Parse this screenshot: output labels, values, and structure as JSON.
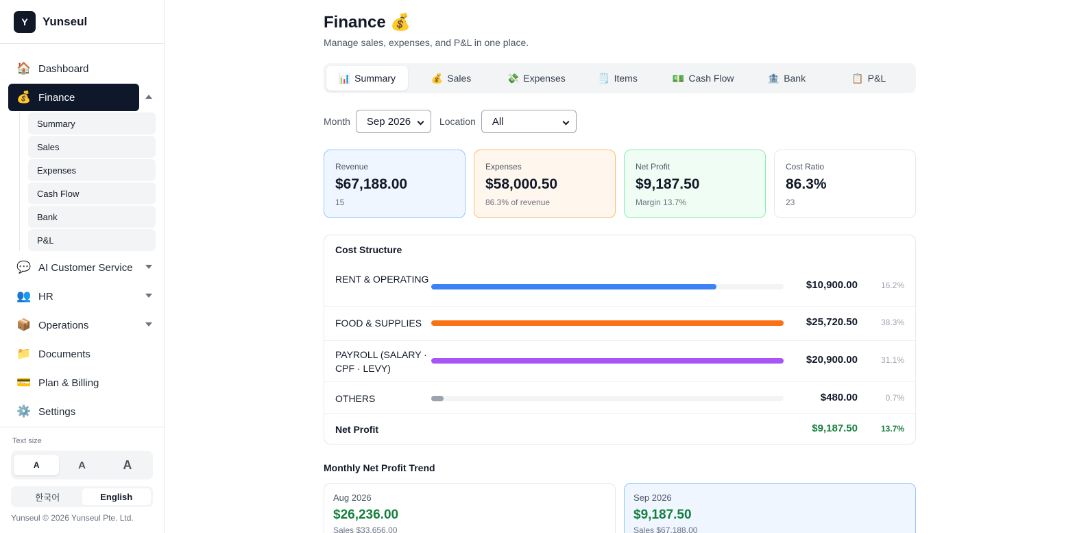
{
  "brand": {
    "logo_letter": "Y",
    "name": "Yunseul"
  },
  "sidebar": {
    "items": [
      {
        "icon": "🏠",
        "label": "Dashboard"
      },
      {
        "icon": "💰",
        "label": "Finance"
      },
      {
        "icon": "💬",
        "label": "AI Customer Service"
      },
      {
        "icon": "👥",
        "label": "HR"
      },
      {
        "icon": "📦",
        "label": "Operations"
      },
      {
        "icon": "📁",
        "label": "Documents"
      },
      {
        "icon": "💳",
        "label": "Plan & Billing"
      },
      {
        "icon": "⚙️",
        "label": "Settings"
      }
    ],
    "finance_sub": [
      "Summary",
      "Sales",
      "Expenses",
      "Cash Flow",
      "Bank",
      "P&L"
    ],
    "text_size_label": "Text size",
    "text_sizes": [
      "A",
      "A",
      "A"
    ],
    "languages": [
      "한국어",
      "English"
    ],
    "copyright": "Yunseul © 2026 Yunseul Pte. Ltd."
  },
  "header": {
    "title": "Finance 💰",
    "subtitle": "Manage sales, expenses, and P&L in one place."
  },
  "tabs": [
    {
      "icon": "📊",
      "label": "Summary"
    },
    {
      "icon": "💰",
      "label": "Sales"
    },
    {
      "icon": "💸",
      "label": "Expenses"
    },
    {
      "icon": "🗒️",
      "label": "Items"
    },
    {
      "icon": "💵",
      "label": "Cash Flow"
    },
    {
      "icon": "🏦",
      "label": "Bank"
    },
    {
      "icon": "📋",
      "label": "P&L"
    }
  ],
  "filters": {
    "month_label": "Month",
    "month_value": "Sep 2026",
    "location_label": "Location",
    "location_value": "All"
  },
  "kpis": [
    {
      "label": "Revenue",
      "value": "$67,188.00",
      "sub": "15"
    },
    {
      "label": "Expenses",
      "value": "$58,000.50",
      "sub": "86.3% of revenue"
    },
    {
      "label": "Net Profit",
      "value": "$9,187.50",
      "sub": "Margin 13.7%"
    },
    {
      "label": "Cost Ratio",
      "value": "86.3%",
      "sub": "23"
    }
  ],
  "cost_structure": {
    "title": "Cost Structure",
    "rows": [
      {
        "label": "RENT & OPERATING",
        "amount": "$10,900.00",
        "percent": "16.2%",
        "bar_fill": 0.81,
        "color": "#3b82f6"
      },
      {
        "label": "FOOD & SUPPLIES",
        "amount": "$25,720.50",
        "percent": "38.3%",
        "bar_fill": 1.0,
        "color": "#f97316"
      },
      {
        "label": "PAYROLL (SALARY · CPF · LEVY)",
        "amount": "$20,900.00",
        "percent": "31.1%",
        "bar_fill": 1.0,
        "color": "#a855f7"
      },
      {
        "label": "OTHERS",
        "amount": "$480.00",
        "percent": "0.7%",
        "bar_fill": 0.035,
        "color": "#9ca3af"
      }
    ],
    "net": {
      "label": "Net Profit",
      "amount": "$9,187.50",
      "percent": "13.7%"
    }
  },
  "trend": {
    "title": "Monthly Net Profit Trend",
    "cards": [
      {
        "month": "Aug 2026",
        "value": "$26,236.00",
        "sales": "Sales $33,656.00"
      },
      {
        "month": "Sep 2026",
        "value": "$9,187.50",
        "sales": "Sales $67,188.00"
      }
    ]
  }
}
